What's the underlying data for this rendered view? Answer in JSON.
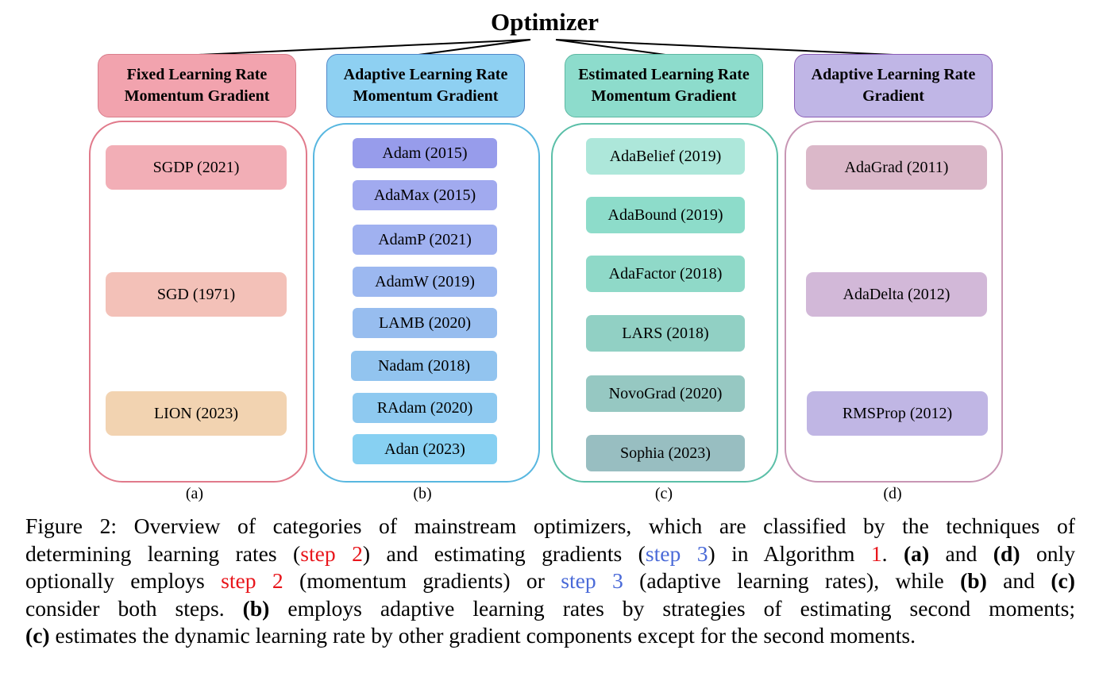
{
  "diagram": {
    "root": "Optimizer",
    "categories": [
      {
        "id": "a",
        "title_line1": "Fixed Learning Rate",
        "title_line2": "Momentum Gradient",
        "header_color": "#f2a3ae",
        "header_border": "#d97e8c",
        "panel_border": "#e17a8b",
        "sub_label": "(a)",
        "items": [
          {
            "label": "SGDP (2021)",
            "color": "#f2aeb6"
          },
          {
            "label": "SGD (1971)",
            "color": "#f3c1b8"
          },
          {
            "label": "LION (2023)",
            "color": "#f2d3b1"
          }
        ]
      },
      {
        "id": "b",
        "title_line1": "Adaptive Learning Rate",
        "title_line2": "Momentum Gradient",
        "header_color": "#8ed0f2",
        "header_border": "#4f87c9",
        "panel_border": "#58b7e0",
        "sub_label": "(b)",
        "items": [
          {
            "label": "Adam (2015)",
            "color": "#979ceb"
          },
          {
            "label": "AdaMax (2015)",
            "color": "#a1aaef"
          },
          {
            "label": "AdamP (2021)",
            "color": "#a0b1f0"
          },
          {
            "label": "AdamW (2019)",
            "color": "#9cb8f0"
          },
          {
            "label": "LAMB (2020)",
            "color": "#97bdef"
          },
          {
            "label": "Nadam (2018)",
            "color": "#92c4ef"
          },
          {
            "label": "RAdam (2020)",
            "color": "#8ec9f0"
          },
          {
            "label": "Adan (2023)",
            "color": "#87d0f2"
          }
        ]
      },
      {
        "id": "c",
        "title_line1": "Estimated Learning Rate",
        "title_line2": "Momentum Gradient",
        "header_color": "#8ddccc",
        "header_border": "#5db8a2",
        "panel_border": "#5bbfa8",
        "sub_label": "(c)",
        "items": [
          {
            "label": "AdaBelief (2019)",
            "color": "#ade7da"
          },
          {
            "label": "AdaBound (2019)",
            "color": "#8ddcca"
          },
          {
            "label": "AdaFactor (2018)",
            "color": "#8fd9c8"
          },
          {
            "label": "LARS (2018)",
            "color": "#91d0c4"
          },
          {
            "label": "NovoGrad (2020)",
            "color": "#96c8c2"
          },
          {
            "label": "Sophia (2023)",
            "color": "#98bec1"
          }
        ]
      },
      {
        "id": "d",
        "title_line1": "Adaptive Learning Rate",
        "title_line2": "Gradient",
        "header_color": "#c0b6e6",
        "header_border": "#8a5cb6",
        "panel_border": "#c896b4",
        "sub_label": "(d)",
        "items": [
          {
            "label": "AdaGrad (2011)",
            "color": "#dbb8c9"
          },
          {
            "label": "AdaDelta (2012)",
            "color": "#d2b8d8"
          },
          {
            "label": "RMSProp (2012)",
            "color": "#c0b6e4"
          }
        ]
      }
    ]
  },
  "caption": {
    "line1": "Figure 2: Overview of categories of mainstream optimizers, which are classified by the techniques of",
    "line2_a": "determining learning rates (",
    "line2_step2": "step 2",
    "line2_b": ") and estimating gradients (",
    "line2_step3": "step 3",
    "line2_c": ") in Algorithm ",
    "line2_alg": "1",
    "line2_d": ". ",
    "line2_bold_a": "(a)",
    "line2_e": " and ",
    "line2_bold_d": "(d)",
    "line2_f": " only",
    "line3_a": "optionally employs ",
    "line3_step2": "step 2",
    "line3_b": " (momentum gradients) or ",
    "line3_step3": "step 3",
    "line3_c": " (adaptive learning rates), while ",
    "line3_bold_b": "(b)",
    "line3_d": " and ",
    "line3_bold_c": "(c)",
    "line4_a": "consider both steps. ",
    "line4_bold_b": "(b)",
    "line4_b": " employs adaptive learning rates by strategies of estimating second moments;",
    "line5_bold_c": "(c)",
    "line5_a": " estimates the dynamic learning rate by other gradient components except for the second moments."
  }
}
